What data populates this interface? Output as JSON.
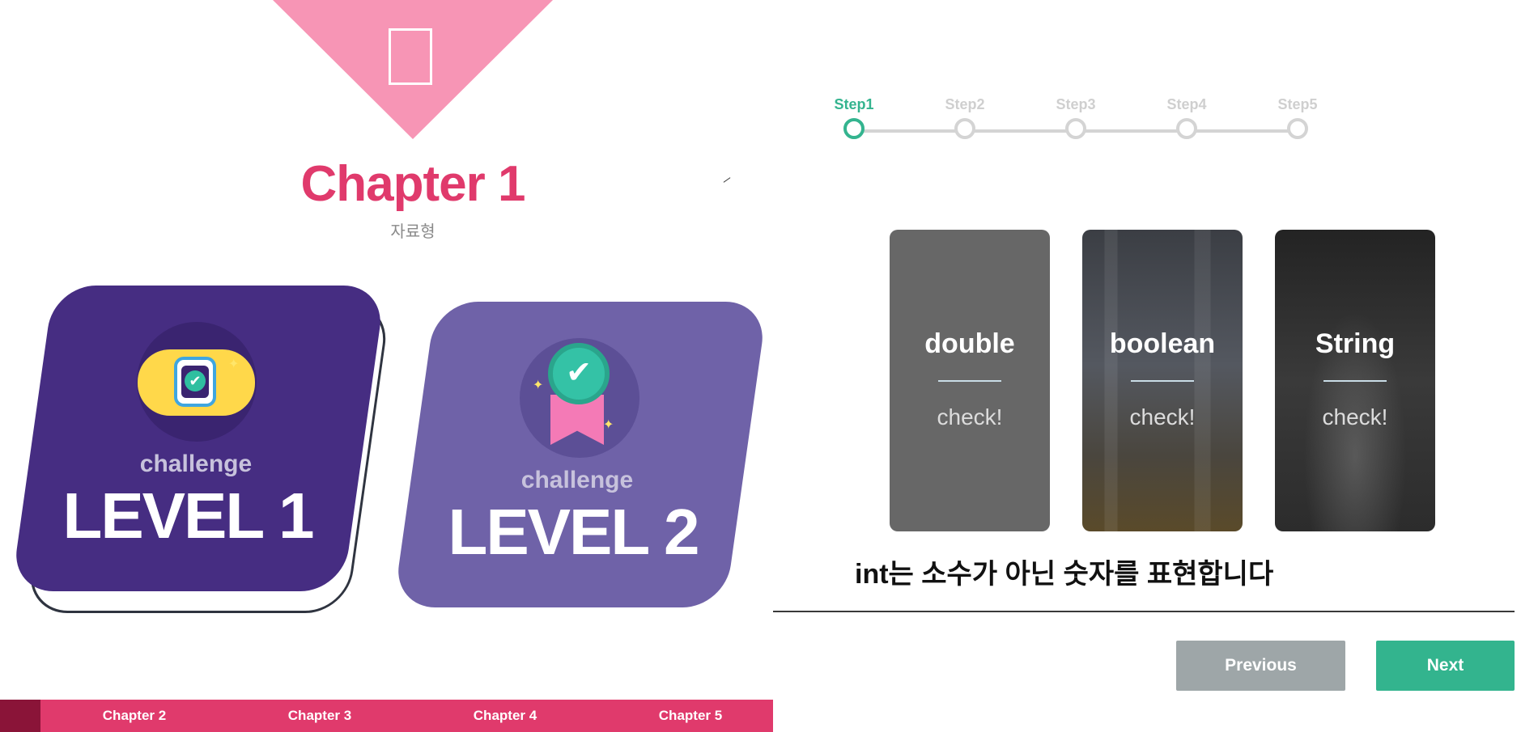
{
  "chapter": {
    "title": "Chapter 1",
    "subtitle": "자료형"
  },
  "levels": [
    {
      "challenge_label": "challenge",
      "level_label": "LEVEL 1",
      "icon": "smartwatch-check-icon"
    },
    {
      "challenge_label": "challenge",
      "level_label": "LEVEL 2",
      "icon": "award-badge-icon"
    }
  ],
  "chapter_nav": [
    "Chapter 2",
    "Chapter 3",
    "Chapter 4",
    "Chapter 5"
  ],
  "steps": [
    {
      "label": "Step1",
      "active": true
    },
    {
      "label": "Step2",
      "active": false
    },
    {
      "label": "Step3",
      "active": false
    },
    {
      "label": "Step4",
      "active": false
    },
    {
      "label": "Step5",
      "active": false
    }
  ],
  "cards": [
    {
      "title": "double",
      "check": "check!"
    },
    {
      "title": "boolean",
      "check": "check!"
    },
    {
      "title": "String",
      "check": "check!"
    }
  ],
  "hint": "int는 소수가 아닌 숫자를 표현합니다",
  "buttons": {
    "previous": "Previous",
    "next": "Next"
  },
  "colors": {
    "accent_pink": "#e03a6c",
    "banner_pink": "#f795b5",
    "level1_purple": "#462d82",
    "level2_purple": "#6f62a8",
    "step_active_green": "#34b48f",
    "prev_button_gray": "#9ea6a8",
    "next_button_green": "#33b48e"
  }
}
